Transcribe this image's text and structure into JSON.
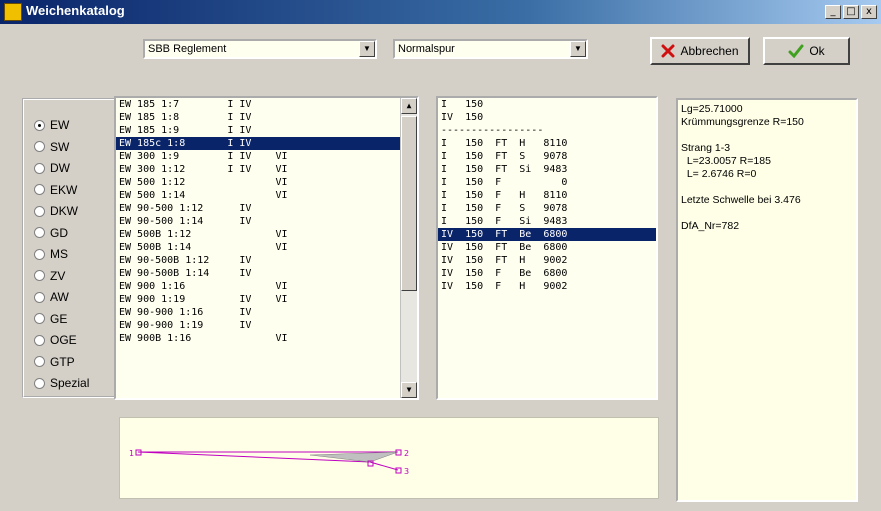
{
  "window": {
    "title": "Weichenkatalog"
  },
  "titlebar_buttons": [
    "_",
    "□",
    "x"
  ],
  "combo_reglement": {
    "value": "SBB Reglement"
  },
  "combo_spur": {
    "value": "Normalspur"
  },
  "buttons": {
    "cancel": "Abbrechen",
    "ok": "Ok"
  },
  "radio_options": [
    {
      "label": "EW",
      "selected": true
    },
    {
      "label": "SW",
      "selected": false
    },
    {
      "label": "DW",
      "selected": false
    },
    {
      "label": "EKW",
      "selected": false
    },
    {
      "label": "DKW",
      "selected": false
    },
    {
      "label": "GD",
      "selected": false
    },
    {
      "label": "MS",
      "selected": false
    },
    {
      "label": "ZV",
      "selected": false
    },
    {
      "label": "AW",
      "selected": false
    },
    {
      "label": "GE",
      "selected": false
    },
    {
      "label": "OGE",
      "selected": false
    },
    {
      "label": "GTP",
      "selected": false
    },
    {
      "label": "Spezial",
      "selected": false
    }
  ],
  "list_switches": {
    "selected_index": 3,
    "rows": [
      "EW 185 1:7        I IV",
      "EW 185 1:8        I IV",
      "EW 185 1:9        I IV",
      "EW 185c 1:8       I IV",
      "EW 300 1:9        I IV    VI",
      "EW 300 1:12       I IV    VI",
      "EW 500 1:12               VI",
      "EW 500 1:14               VI",
      "EW 90-500 1:12      IV",
      "EW 90-500 1:14      IV",
      "EW 500B 1:12              VI",
      "EW 500B 1:14              VI",
      "EW 90-500B 1:12     IV",
      "EW 90-500B 1:14     IV",
      "EW 900 1:16               VI",
      "EW 900 1:19         IV    VI",
      "EW 90-900 1:16      IV",
      "EW 90-900 1:19      IV",
      "EW 900B 1:16              VI"
    ]
  },
  "list_variants": {
    "selected_index": 11,
    "rows": [
      "I   150",
      "IV  150",
      "-----------------",
      "I   150  FT  H   8110",
      "I   150  FT  S   9078",
      "I   150  FT  Si  9483",
      "I   150  F          0",
      "I   150  F   H   8110",
      "I   150  F   S   9078",
      "I   150  F   Si  9483",
      "IV  150  FT  Be  6800",
      "IV  150  FT  Be  6800",
      "IV  150  FT  H   9002",
      "IV  150  F   Be  6800",
      "IV  150  F   H   9002"
    ]
  },
  "info_lines": [
    "Lg=25.71000",
    "Krümmungsgrenze R=150",
    "",
    "Strang 1-3",
    "  L=23.0057 R=185",
    "  L= 2.6746 R=0",
    "",
    "Letzte Schwelle bei 3.476",
    "",
    "DfA_Nr=782"
  ],
  "diagram": {
    "labels": [
      "1",
      "2",
      "3"
    ],
    "line_color": "#c000c0"
  }
}
